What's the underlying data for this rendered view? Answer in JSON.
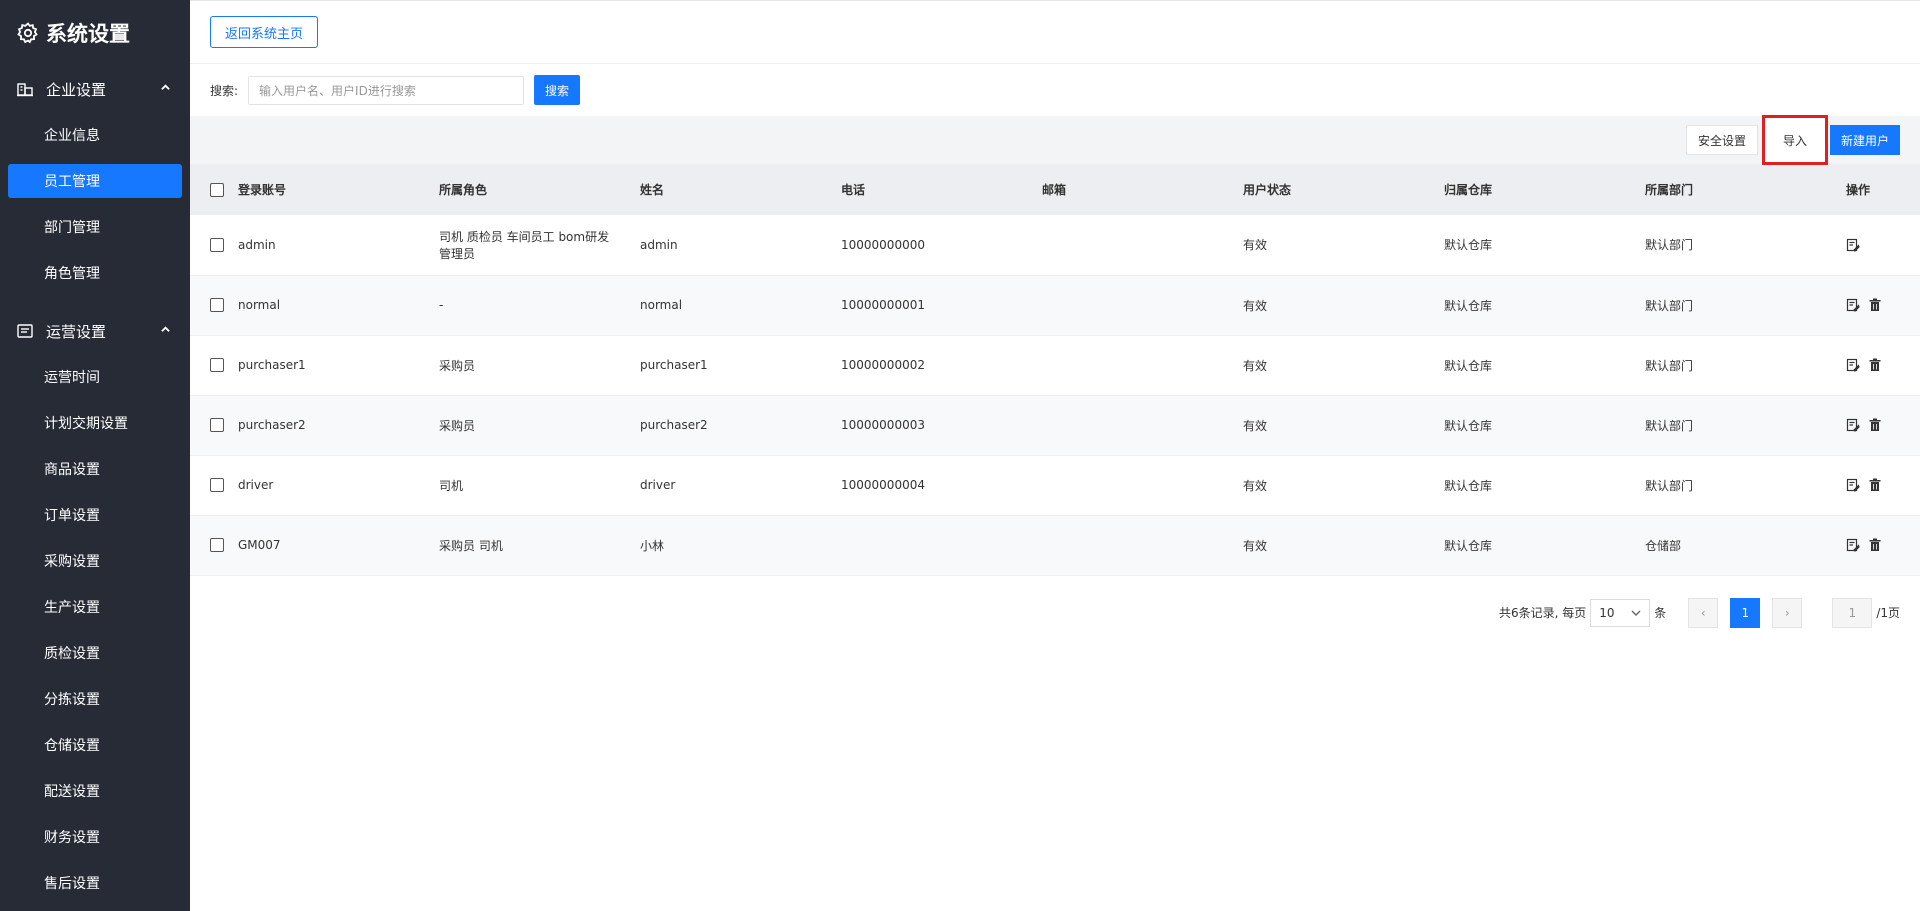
{
  "sidebar": {
    "title": "系统设置",
    "groups": [
      {
        "label": "企业设置",
        "items": [
          "企业信息",
          "员工管理",
          "部门管理",
          "角色管理"
        ],
        "active": "员工管理"
      },
      {
        "label": "运营设置",
        "items": [
          "运营时间",
          "计划交期设置",
          "商品设置",
          "订单设置",
          "采购设置",
          "生产设置",
          "质检设置",
          "分拣设置",
          "仓储设置",
          "配送设置",
          "财务设置",
          "售后设置"
        ]
      }
    ]
  },
  "topbar": {
    "back_label": "返回系统主页"
  },
  "search": {
    "label": "搜索:",
    "placeholder": "输入用户名、用户ID进行搜索",
    "button": "搜索"
  },
  "toolbar": {
    "security": "安全设置",
    "import": "导入",
    "new_user": "新建用户"
  },
  "table": {
    "columns": [
      "登录账号",
      "所属角色",
      "姓名",
      "电话",
      "邮箱",
      "用户状态",
      "归属仓库",
      "所属部门",
      "操作"
    ],
    "rows": [
      [
        "admin",
        "司机 质检员 车间员工 bom研发管理员",
        "admin",
        "10000000000",
        "",
        "有效",
        "默认仓库",
        "默认部门"
      ],
      [
        "normal",
        "-",
        "normal",
        "10000000001",
        "",
        "有效",
        "默认仓库",
        "默认部门"
      ],
      [
        "purchaser1",
        "采购员",
        "purchaser1",
        "10000000002",
        "",
        "有效",
        "默认仓库",
        "默认部门"
      ],
      [
        "purchaser2",
        "采购员",
        "purchaser2",
        "10000000003",
        "",
        "有效",
        "默认仓库",
        "默认部门"
      ],
      [
        "driver",
        "司机",
        "driver",
        "10000000004",
        "",
        "有效",
        "默认仓库",
        "默认部门"
      ],
      [
        "GM007",
        "采购员 司机",
        "小林",
        "",
        "",
        "有效",
        "默认仓库",
        "仓储部"
      ]
    ]
  },
  "pagination": {
    "total_text": "共6条记录, 每页",
    "page_size": "10",
    "unit": "条",
    "prev": "‹",
    "current": "1",
    "next": "›",
    "goto": "1",
    "total_pages": "/1页"
  }
}
